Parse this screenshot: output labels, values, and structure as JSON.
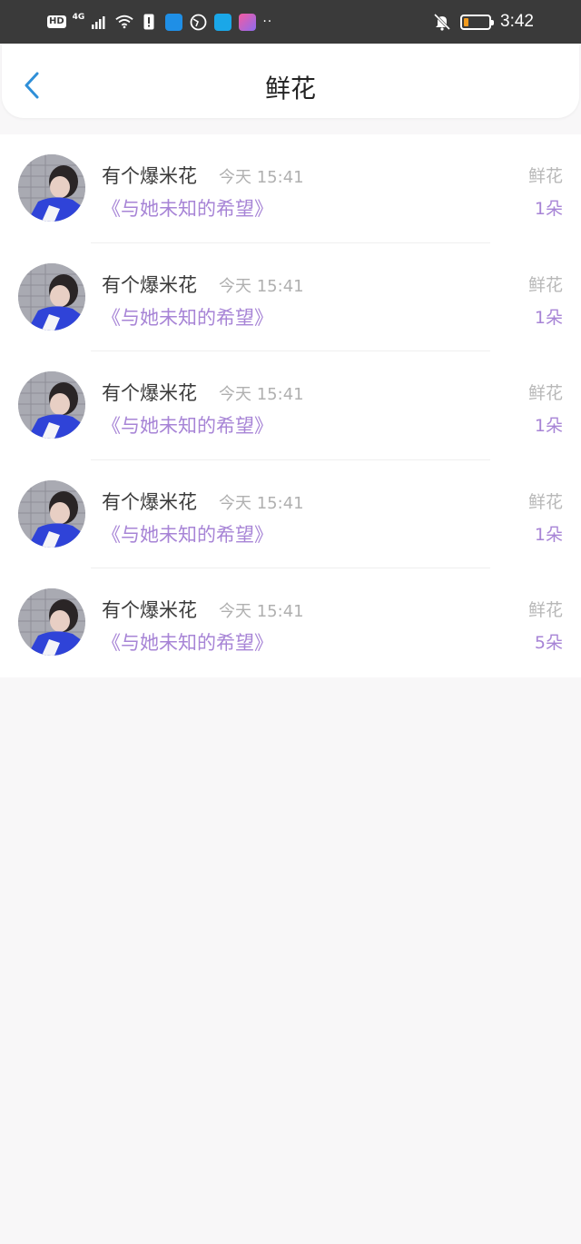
{
  "status_bar": {
    "hd": "HD",
    "network": "4G",
    "time": "3:42",
    "battery_level": 0.2,
    "colors": {
      "background": "#3a3a3a",
      "battery": "#f29b1d"
    },
    "icons": [
      "signal-icon",
      "wifi-icon",
      "sim-alert-icon",
      "cloud-app-icon",
      "browser-icon",
      "search-app-icon",
      "reader-app-icon",
      "more-icon",
      "mute-bell-icon"
    ]
  },
  "header": {
    "title": "鲜花",
    "back_icon": "chevron-left-icon",
    "colors": {
      "back": "#2f8fd8"
    }
  },
  "list": {
    "items": [
      {
        "username": "有个爆米花",
        "time": "今天 15:41",
        "book": "《与她未知的希望》",
        "gift_type": "鲜花",
        "gift_count": "1朵"
      },
      {
        "username": "有个爆米花",
        "time": "今天 15:41",
        "book": "《与她未知的希望》",
        "gift_type": "鲜花",
        "gift_count": "1朵"
      },
      {
        "username": "有个爆米花",
        "time": "今天 15:41",
        "book": "《与她未知的希望》",
        "gift_type": "鲜花",
        "gift_count": "1朵"
      },
      {
        "username": "有个爆米花",
        "time": "今天 15:41",
        "book": "《与她未知的希望》",
        "gift_type": "鲜花",
        "gift_count": "1朵"
      },
      {
        "username": "有个爆米花",
        "time": "今天 15:41",
        "book": "《与她未知的希望》",
        "gift_type": "鲜花",
        "gift_count": "5朵"
      }
    ],
    "colors": {
      "accent": "#a784d6",
      "muted": "#b8b8b8",
      "name": "#3b3b3b"
    }
  }
}
